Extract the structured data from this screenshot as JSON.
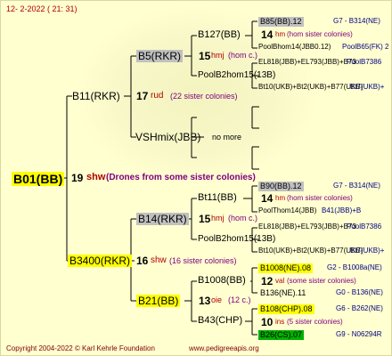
{
  "header": {
    "date": "12-  2-2022 ( 21: 31)"
  },
  "root": {
    "name": "B01(BB)",
    "gen": "19",
    "breed": "shw",
    "note": "(Drones from some sister colonies)"
  },
  "gen1": [
    {
      "name": "B11(RKR)",
      "gen": "17",
      "breed": "rud",
      "note": "(22 sister colonies)"
    },
    {
      "name": "B3400(RKR)",
      "gen": "16",
      "breed": "shw",
      "note": "(16 sister colonies)"
    }
  ],
  "gen2": [
    {
      "name": "B5(RKR)",
      "gen": "15",
      "breed": "hmj",
      "note": "(hom c.)"
    },
    {
      "name": "VSHmix(JBB)",
      "note": "no more"
    },
    {
      "name": "B14(RKR)",
      "gen": "15",
      "breed": "hmj",
      "note": "(hom c.)"
    },
    {
      "name": "B21(BB)",
      "gen": "13",
      "breed": "oie",
      "note": "(12 c.)"
    }
  ],
  "gen3": [
    {
      "name": "B127(BB)"
    },
    {
      "name": "PoolB2hom15(13B)"
    },
    {
      "name": "Bt11(BB)"
    },
    {
      "name": "PoolB2hom15(13B)"
    },
    {
      "name": "B1008(BB)"
    },
    {
      "name": "B43(CHP)"
    }
  ],
  "gen4": [
    {
      "name": "B85(BB).12",
      "id": "G7 - B314(NE)"
    },
    {
      "gen": "14",
      "breed": "hm",
      "note": "(hom sister colonies)"
    },
    {
      "name": "PoolBhom14(JBB0.12)",
      "id": "PoolB65(FK) 2"
    },
    {
      "name": "EL818(JBB)+EL793(JBB)+B73",
      "id": "PoolB7386"
    },
    {
      "name": "Bt10(UKB)+Bt2(UKB)+B77(UKB)",
      "id": "Bt7(UKB)+"
    },
    {
      "name": "B90(BB).12",
      "id": "G7 - B314(NE)"
    },
    {
      "gen": "14",
      "breed": "hm",
      "note": "(hom sister colonies)"
    },
    {
      "name": "PoolThom14(JBB)",
      "id": "B41(JBB)+B"
    },
    {
      "name": "EL818(JBB)+EL793(JBB)+B73",
      "id": "PoolB7386"
    },
    {
      "name": "Bt10(UKB)+Bt2(UKB)+B77(UKB)",
      "id": "Bt7(UKB)+"
    },
    {
      "name": "B1008(NE).08",
      "id": "G2 - B1008a(NE)"
    },
    {
      "gen": "12",
      "breed": "val",
      "note": "(some sister colonies)"
    },
    {
      "name": "B136(NE).11",
      "id": "G0 - B136(NE)"
    },
    {
      "name": "B108(CHP).08",
      "id": "G6 - B262(NE)"
    },
    {
      "gen": "10",
      "breed": "ins",
      "note": "(5 sister colonies)"
    },
    {
      "name": "B26(CS).07",
      "id": "G9 - N06294R"
    }
  ],
  "footer": {
    "copyright": "Copyright 2004-2022 © Karl Kehrle Foundation",
    "url": "www.pedigreeapis.org"
  }
}
